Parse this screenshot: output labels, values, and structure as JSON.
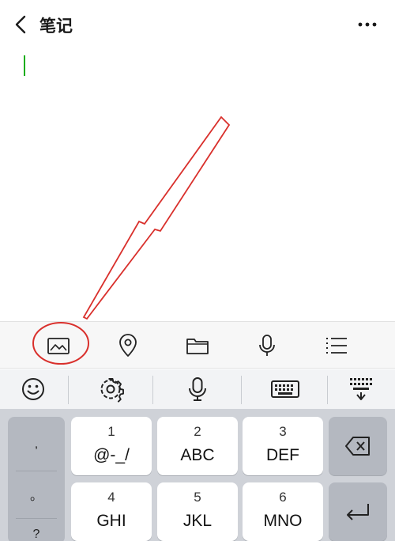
{
  "header": {
    "back_icon": "chevron-left-icon",
    "title": "笔记",
    "more_icon": "ellipsis-icon"
  },
  "editor": {
    "caret_color": "#1aad19"
  },
  "annotation": {
    "color": "#d9302c",
    "shapes": [
      "arrow",
      "ellipse"
    ]
  },
  "toolbar": {
    "items": [
      {
        "icon": "image-icon"
      },
      {
        "icon": "location-icon"
      },
      {
        "icon": "folder-icon"
      },
      {
        "icon": "microphone-icon"
      },
      {
        "icon": "list-icon"
      }
    ]
  },
  "keyboard_bar": {
    "items": [
      {
        "icon": "emoji-icon"
      },
      {
        "icon": "settings-icon"
      },
      {
        "icon": "voice-input-icon"
      },
      {
        "icon": "keyboard-icon"
      },
      {
        "icon": "hide-keyboard-icon"
      }
    ]
  },
  "keyboard": {
    "punctuation": [
      ",",
      "。",
      "?"
    ],
    "keys": [
      {
        "num": "1",
        "letters": "@-_/"
      },
      {
        "num": "2",
        "letters": "ABC"
      },
      {
        "num": "3",
        "letters": "DEF"
      },
      {
        "num": "4",
        "letters": "GHI"
      },
      {
        "num": "5",
        "letters": "JKL"
      },
      {
        "num": "6",
        "letters": "MNO"
      }
    ],
    "backspace_icon": "backspace-icon",
    "enter_icon": "enter-icon"
  }
}
